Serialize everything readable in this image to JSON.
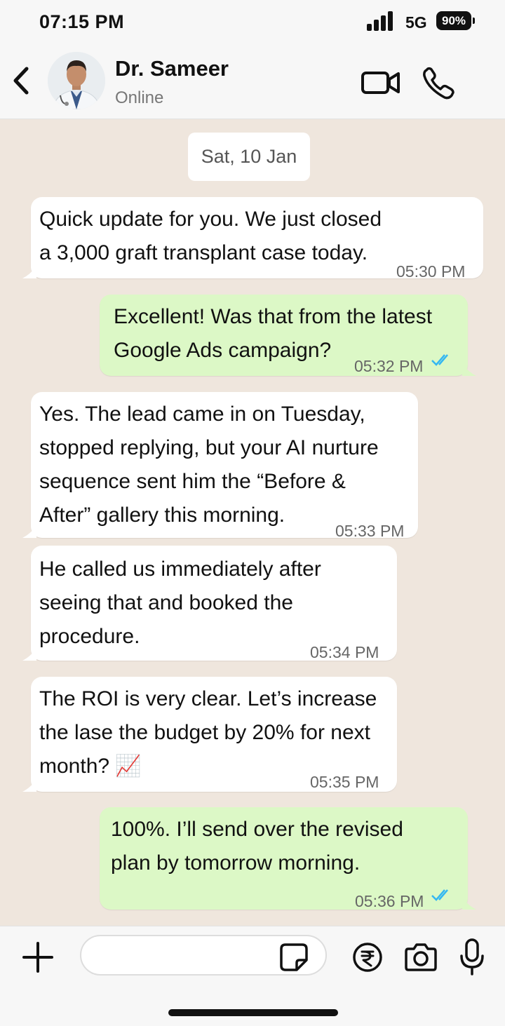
{
  "status_bar": {
    "time": "07:15 PM",
    "network": "5G",
    "battery": "90%"
  },
  "header": {
    "name": "Dr. Sameer",
    "status": "Online"
  },
  "chat": {
    "date": "Sat, 10 Jan",
    "messages": [
      {
        "dir": "in",
        "lines": [
          "Quick update for you. We just closed",
          "a 3,000 graft transplant case today."
        ],
        "time": "05:30 PM"
      },
      {
        "dir": "out",
        "lines": [
          "Excellent! Was that from the latest",
          "Google Ads campaign?"
        ],
        "time": "05:32 PM"
      },
      {
        "dir": "in",
        "lines": [
          "Yes. The lead came in on Tuesday,",
          "stopped replying, but your AI nurture",
          "sequence sent him the “Before &",
          "After” gallery this morning."
        ],
        "time": "05:33 PM"
      },
      {
        "dir": "in",
        "lines": [
          "He called us immediately after",
          "seeing that and booked the",
          "procedure."
        ],
        "time": "05:34 PM"
      },
      {
        "dir": "in",
        "lines": [
          "The ROI is very clear. Let’s increase",
          "the lase the budget by 20% for next",
          "month? 📈"
        ],
        "time": "05:35 PM"
      },
      {
        "dir": "out",
        "lines": [
          "100%. I’ll send over the revised",
          "plan by tomorrow morning."
        ],
        "time": "05:36 PM"
      }
    ]
  },
  "input": {
    "placeholder": ""
  },
  "colors": {
    "incoming": "#ffffff",
    "outgoing": "#dcf8c6",
    "read_ticks": "#34b7f1",
    "chat_bg": "#efe6dd"
  },
  "icons": [
    "chevron-left-icon",
    "video-call-icon",
    "phone-icon",
    "plus-icon",
    "sticker-icon",
    "rupee-icon",
    "camera-icon",
    "mic-icon"
  ]
}
